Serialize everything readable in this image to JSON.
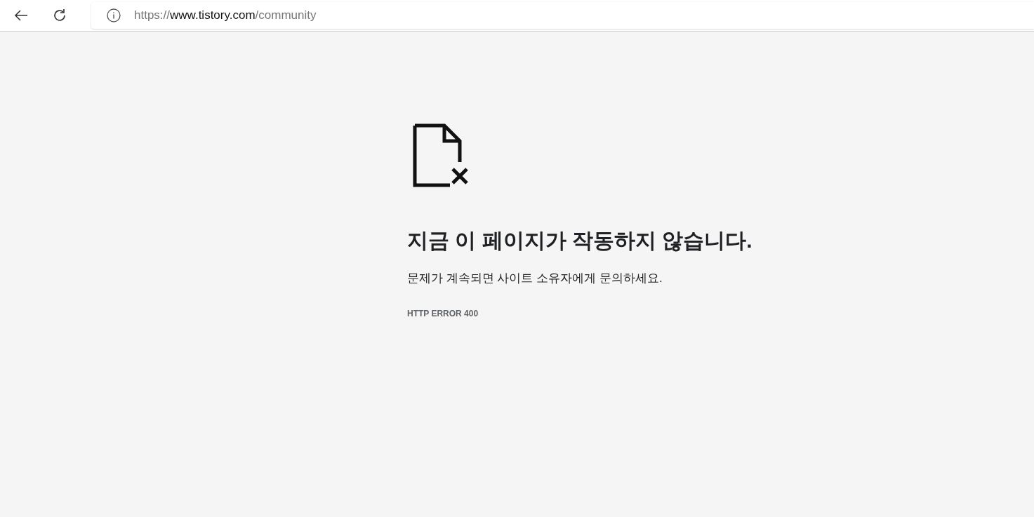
{
  "toolbar": {
    "url": {
      "scheme": "https://",
      "host": "www.tistory.com",
      "path": "/community"
    }
  },
  "error": {
    "heading": "지금 이 페이지가 작동하지 않습니다.",
    "message": "문제가 계속되면 사이트 소유자에게 문의하세요.",
    "code": "HTTP ERROR 400"
  }
}
